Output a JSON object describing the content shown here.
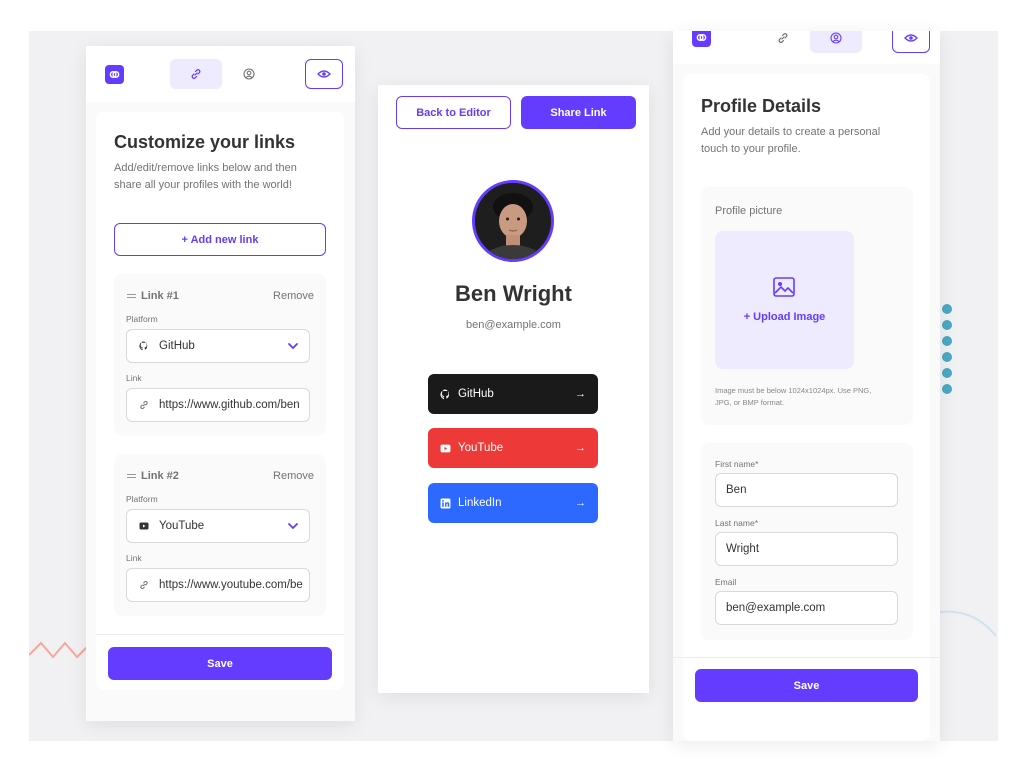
{
  "nav": {
    "icons": [
      "logo-icon",
      "link-icon",
      "profile-icon",
      "eye-icon"
    ]
  },
  "links_editor": {
    "title": "Customize your links",
    "subtitle_line1": "Add/edit/remove links below and then",
    "subtitle_line2": "share all your profiles with the world!",
    "add_button": "+ Add new link",
    "links": [
      {
        "heading": "Link #1",
        "remove": "Remove",
        "platform_label": "Platform",
        "platform": "GitHub",
        "link_label": "Link",
        "url": "https://www.github.com/ben"
      },
      {
        "heading": "Link #2",
        "remove": "Remove",
        "platform_label": "Platform",
        "platform": "YouTube",
        "link_label": "Link",
        "url": "https://www.youtube.com/be"
      }
    ],
    "save": "Save"
  },
  "preview": {
    "back_button": "Back to Editor",
    "share_button": "Share Link",
    "name": "Ben Wright",
    "email": "ben@example.com",
    "links": [
      {
        "label": "GitHub",
        "color": "#1a1a1a",
        "icon": "github-icon"
      },
      {
        "label": "YouTube",
        "color": "#ee3939",
        "icon": "youtube-icon"
      },
      {
        "label": "LinkedIn",
        "color": "#2d68ff",
        "icon": "linkedin-icon"
      }
    ]
  },
  "profile_details": {
    "title": "Profile Details",
    "subtitle_line1": "Add your details to create a personal",
    "subtitle_line2": "touch to your profile.",
    "picture_label": "Profile picture",
    "upload": "+ Upload Image",
    "note_line1": "Image must be below 1024x1024px. Use PNG,",
    "note_line2": "JPG, or BMP format.",
    "first_name_label": "First name*",
    "first_name": "Ben",
    "last_name_label": "Last name*",
    "last_name": "Wright",
    "email_label": "Email",
    "email": "ben@example.com",
    "save": "Save"
  },
  "colors": {
    "accent": "#633cff",
    "accent_light": "#efebff",
    "github": "#1a1a1a",
    "youtube": "#ee3939",
    "linkedin": "#2d68ff",
    "decor_teal": "#4aa8c0",
    "decor_pink": "#f4a79d"
  }
}
